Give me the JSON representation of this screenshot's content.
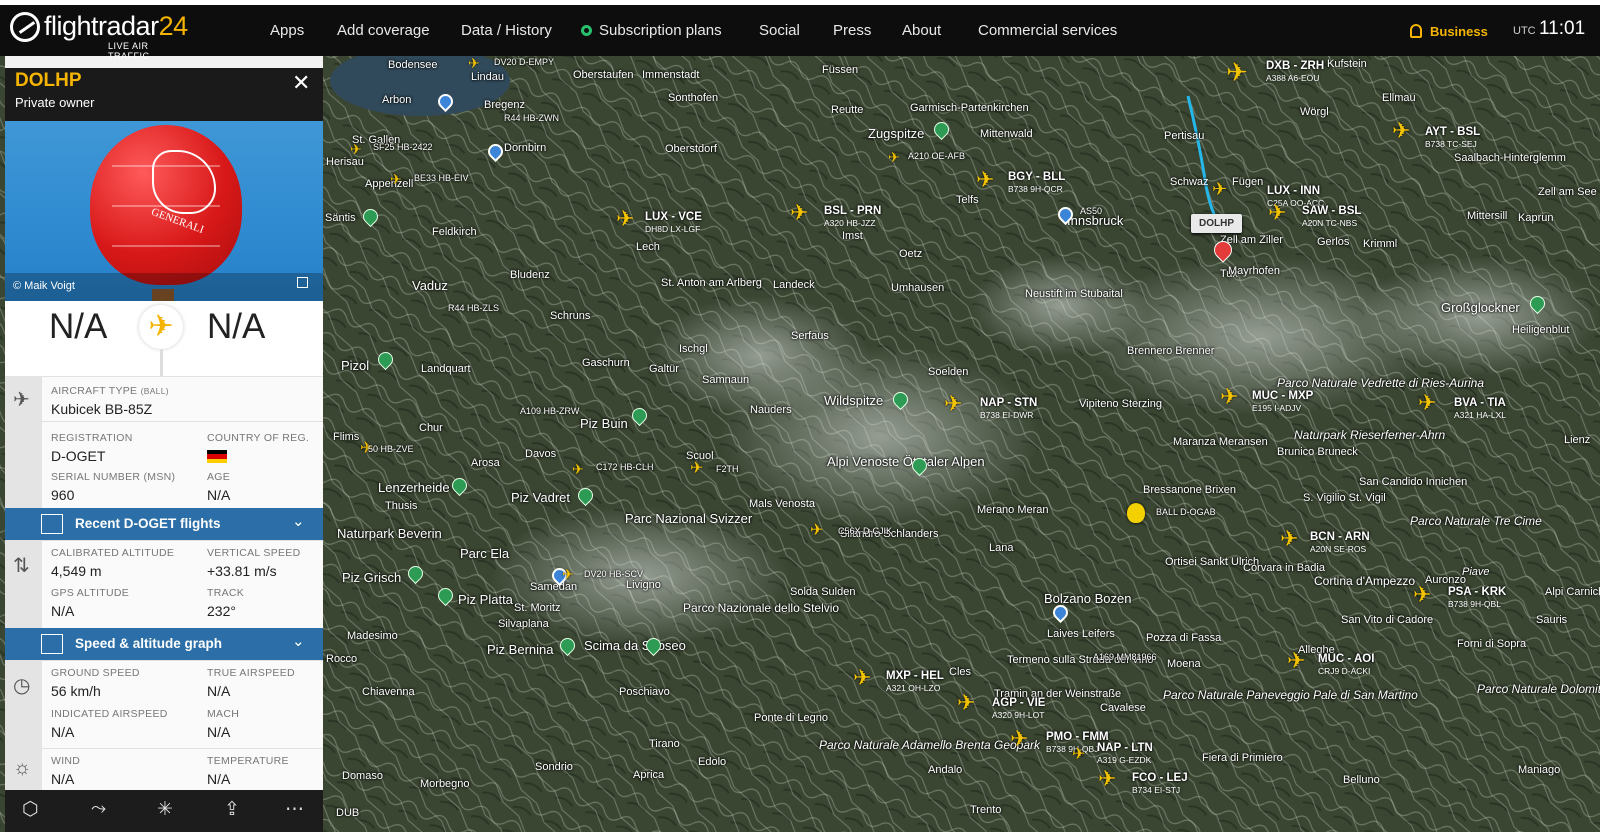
{
  "header": {
    "logo_text": "flightradar",
    "logo_num": "24",
    "logo_tagline": "LIVE AIR TRAFFIC",
    "nav": [
      "Apps",
      "Add coverage",
      "Data / History",
      "Subscription plans",
      "Social",
      "Press",
      "About",
      "Commercial services"
    ],
    "business_label": "Business",
    "utc_label": "UTC",
    "time": "11:01"
  },
  "panel": {
    "callsign": "DOLHP",
    "owner": "Private owner",
    "photo_credit": "© Maik Voigt",
    "balloon_text": "GENERALI",
    "from_code": "N/A",
    "to_code": "N/A",
    "aircraft_type_label": "AIRCRAFT TYPE",
    "aircraft_type_code": "(BALL)",
    "aircraft_type_value": "Kubicek BB-85Z",
    "registration_label": "REGISTRATION",
    "registration_value": "D-OGET",
    "country_label": "COUNTRY OF REG.",
    "serial_label": "SERIAL NUMBER (MSN)",
    "serial_value": "960",
    "age_label": "AGE",
    "age_value": "N/A",
    "recent_flights_label": "Recent D-OGET flights",
    "cal_alt_label": "CALIBRATED ALTITUDE",
    "cal_alt_value": "4,549 m",
    "vspeed_label": "VERTICAL SPEED",
    "vspeed_value": "+33.81 m/s",
    "gps_alt_label": "GPS ALTITUDE",
    "gps_alt_value": "N/A",
    "track_label": "TRACK",
    "track_value": "232°",
    "graph_label": "Speed & altitude graph",
    "ground_speed_label": "GROUND SPEED",
    "ground_speed_value": "56 km/h",
    "true_airspeed_label": "TRUE AIRSPEED",
    "true_airspeed_value": "N/A",
    "ias_label": "INDICATED AIRSPEED",
    "ias_value": "N/A",
    "mach_label": "MACH",
    "mach_value": "N/A",
    "wind_label": "WIND",
    "wind_value": "N/A",
    "temp_label": "TEMPERATURE",
    "temp_value": "N/A"
  },
  "map": {
    "selected_tag": "DOLHP",
    "balloon_label": "BALL D-OGAB",
    "traffic": [
      {
        "route": "DXB - ZRH",
        "meta": "A388 A6-EOU"
      },
      {
        "route": "AYT - BSL",
        "meta": "B738 TC-SEJ"
      },
      {
        "route": "BGY - BLL",
        "meta": "B738 9H-QCR"
      },
      {
        "route": "LUX - INN",
        "meta": "C25A OO-ACC"
      },
      {
        "route": "SAW - BSL",
        "meta": "A20N TC-NBS"
      },
      {
        "route": "BSL - PRN",
        "meta": "A320 HB-JZZ"
      },
      {
        "route": "LUX - VCE",
        "meta": "DH8D LX-LGF"
      },
      {
        "route": "NAP - STN",
        "meta": "B738 EI-DWR"
      },
      {
        "route": "MUC - MXP",
        "meta": "E195 I-ADJV"
      },
      {
        "route": "BVA - TIA",
        "meta": "A321 HA-LXL"
      },
      {
        "route": "BCN - ARN",
        "meta": "A20N SE-ROS"
      },
      {
        "route": "PSA - KRK",
        "meta": "B738 9H-QBL"
      },
      {
        "route": "MUC - AOI",
        "meta": "CRJ9 D-ACKI"
      },
      {
        "route": "MXP - HEL",
        "meta": "A321 OH-LZO"
      },
      {
        "route": "AGP - VIE",
        "meta": "A320 9H-LOT"
      },
      {
        "route": "PMO - FMM",
        "meta": "B738 9H-QBJ"
      },
      {
        "route": "NAP - LTN",
        "meta": "A319 G-EZDK"
      },
      {
        "route": "FCO - LEJ",
        "meta": "B734 EI-STJ"
      }
    ],
    "small_traffic": [
      "DV20 D-EMPY",
      "R44 HB-ZWN",
      "SF25 HB-2422",
      "BE33 HB-EIV",
      "A210 OE-AFB",
      "AS50",
      "R44 HB-ZLS",
      "A109 HB-ZRW",
      "C172 HB-CLH",
      "F2TH",
      "C56X D-CJIK",
      "A169 MM81966",
      "DV20 HB-SCV",
      "50 HB-ZVE"
    ],
    "places": [
      "Bodensee",
      "Lindau",
      "Oberstaufen",
      "Immenstadt",
      "Füssen",
      "Arbon",
      "Bregenz",
      "Sonthofen",
      "Reutte",
      "Garmisch-Partenkirchen",
      "Kufstein",
      "Ellmau",
      "Wörgl",
      "Zugspitze",
      "Mittenwald",
      "Pertisau",
      "Schwaz",
      "Fügen",
      "St. Gallen",
      "Dornbirn",
      "Oberstdorf",
      "Herisau",
      "Appenzell",
      "Feldkirch",
      "Telfs",
      "Innsbruck",
      "Zell am Ziller",
      "Gerlos",
      "Krimml",
      "Mittersill",
      "Zell am See",
      "Kaprun",
      "Saalbach-Hinterglemm",
      "Säntis",
      "Imst",
      "Oetz",
      "Vaduz",
      "Bludenz",
      "Lech",
      "St. Anton am Arlberg",
      "Landeck",
      "Umhausen",
      "Neustift im Stubaital",
      "Tux",
      "Mayrhofen",
      "Großglockner",
      "Schruns",
      "Serfaus",
      "Brennero Brenner",
      "Heiligenblut",
      "Pizol",
      "Landquart",
      "Ischgl",
      "Gaschurn",
      "Galtür",
      "Samnaun",
      "Soelden",
      "Wildspitze",
      "Parco Naturale Vedrette di Ries-Aurina",
      "Naturpark Rieserferner-Ahrn",
      "Nauders",
      "Vipiteno Sterzing",
      "Flims",
      "Chur",
      "Piz Buin",
      "Maranza Meransen",
      "Brunico Bruneck",
      "Lienz",
      "Arosa",
      "Davos",
      "Scuol",
      "Alpi Venoste Ötztaler Alpen",
      "Lenzerheide",
      "Thusis",
      "Piz Vadret",
      "Mals Venosta",
      "Merano Meran",
      "Bressanone Brixen",
      "S. Vigilio St. Vigil",
      "San Candido Innichen",
      "Parc Nazional Svizzer",
      "Naturpark Beverin",
      "Parc Ela",
      "Silandro Schlanders",
      "Lana",
      "Ortisei Sankt Ulrich",
      "Corvara in Badia",
      "Cortina d'Ampezzo",
      "Parco Naturale Tre Cime",
      "Piz Grisch",
      "Piz Platta",
      "Samedan",
      "Livigno",
      "Solda Sulden",
      "Bolzano Bozen",
      "Auronzo",
      "Alpi Carniche",
      "St. Moritz",
      "Silvaplana",
      "Parco Nazionale dello Stelvio",
      "Laives Leifers",
      "Pozza di Fassa",
      "San Vito di Cadore",
      "Sauris",
      "Madesimo",
      "Piz Bernina",
      "Scima da Saoseo",
      "Moena",
      "Termeno sulla Strada del Vino",
      "Forni di Sopra",
      "Chiavenna",
      "Poschiavo",
      "Cles",
      "Tramin an der Weinstraße",
      "Alleghe",
      "Parco Naturale Dolomiti Friulane",
      "Ponte di Legno",
      "Cavalese",
      "Parco Naturale Paneveggio Pale di San Martino",
      "Tirano",
      "Parco Naturale Adamello Brenta Geopark",
      "Fiera di Primiero",
      "Domaso",
      "Morbegno",
      "Sondrio",
      "Aprica",
      "Edolo",
      "Andalo",
      "Belluno",
      "Maniago",
      "Trento",
      "Piave",
      "Rocco",
      "DUB"
    ]
  }
}
